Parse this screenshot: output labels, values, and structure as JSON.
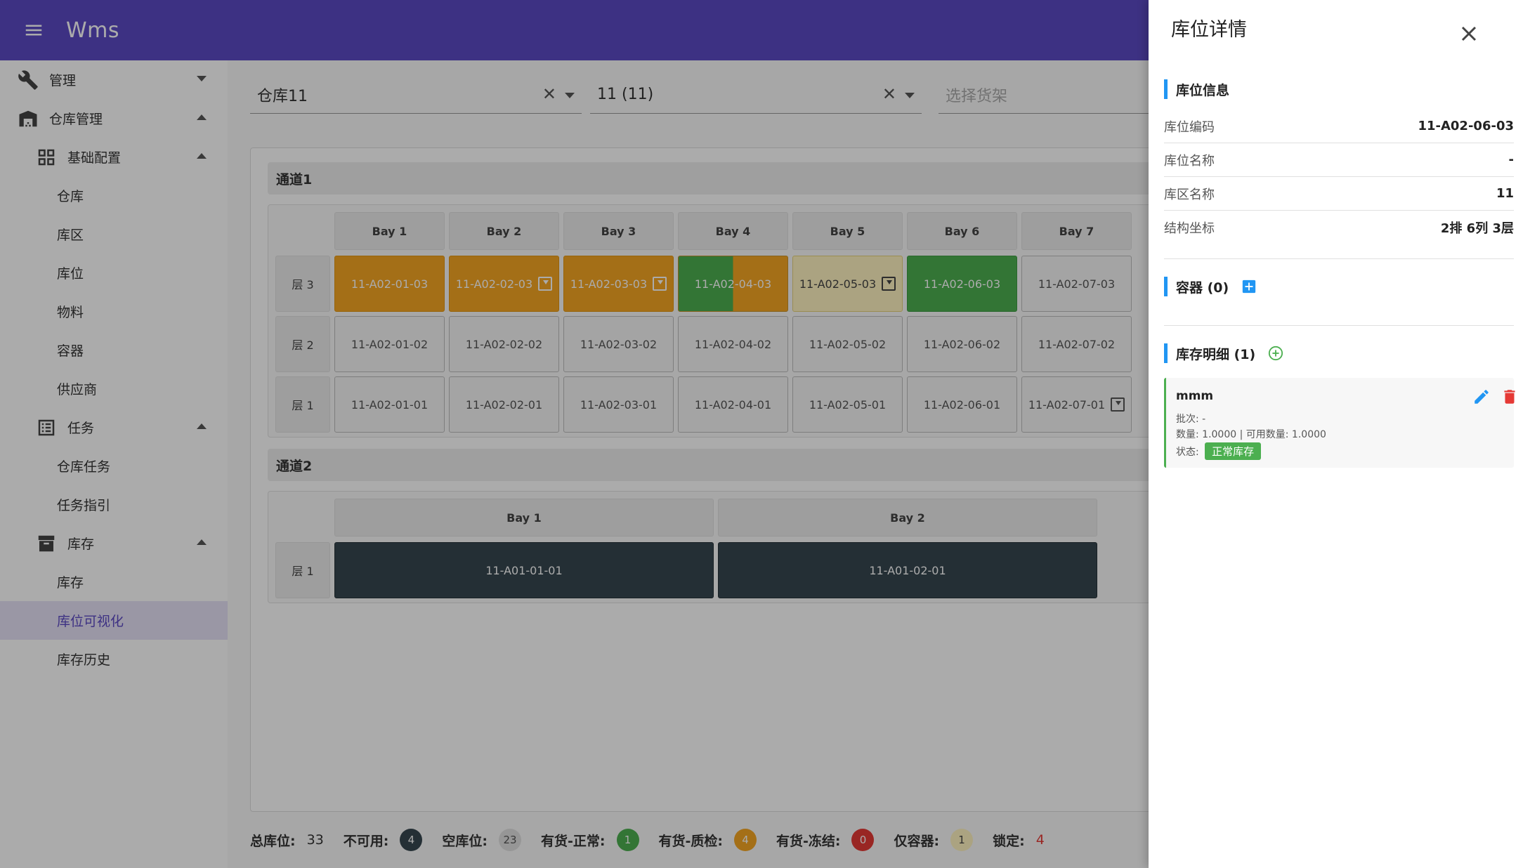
{
  "app": {
    "title": "Wms"
  },
  "sidebar": {
    "groups": [
      {
        "label": "管理"
      },
      {
        "label": "仓库管理"
      },
      {
        "label": "基础配置"
      },
      {
        "label": "任务"
      },
      {
        "label": "库存"
      }
    ],
    "items": [
      {
        "label": "仓库"
      },
      {
        "label": "库区"
      },
      {
        "label": "库位"
      },
      {
        "label": "物料"
      },
      {
        "label": "容器"
      },
      {
        "label": "供应商"
      },
      {
        "label": "仓库任务"
      },
      {
        "label": "任务指引"
      },
      {
        "label": "库存"
      },
      {
        "label": "库位可视化"
      },
      {
        "label": "库存历史"
      }
    ]
  },
  "filters": {
    "warehouse": "仓库11",
    "zone": "11 (11)",
    "shelf_placeholder": "选择货架"
  },
  "aisle1": {
    "name": "通道1",
    "bays": [
      "Bay 1",
      "Bay 2",
      "Bay 3",
      "Bay 4",
      "Bay 5",
      "Bay 6",
      "Bay 7"
    ],
    "levels": [
      {
        "label": "层 3",
        "cells": [
          {
            "code": "11-A02-01-03",
            "status": "qc",
            "icon": ""
          },
          {
            "code": "11-A02-02-03",
            "status": "qc",
            "icon": "inbox-icon"
          },
          {
            "code": "11-A02-03-03",
            "status": "qc",
            "icon": "inbox-icon"
          },
          {
            "code": "11-A02-04-03",
            "status": "split",
            "icon": ""
          },
          {
            "code": "11-A02-05-03",
            "status": "container",
            "icon": "inbox-icon"
          },
          {
            "code": "11-A02-06-03",
            "status": "normal",
            "icon": ""
          },
          {
            "code": "11-A02-07-03",
            "status": "empty",
            "icon": ""
          }
        ]
      },
      {
        "label": "层 2",
        "cells": [
          {
            "code": "11-A02-01-02",
            "status": "empty",
            "icon": ""
          },
          {
            "code": "11-A02-02-02",
            "status": "empty",
            "icon": ""
          },
          {
            "code": "11-A02-03-02",
            "status": "empty",
            "icon": ""
          },
          {
            "code": "11-A02-04-02",
            "status": "empty",
            "icon": ""
          },
          {
            "code": "11-A02-05-02",
            "status": "empty",
            "icon": ""
          },
          {
            "code": "11-A02-06-02",
            "status": "empty",
            "icon": ""
          },
          {
            "code": "11-A02-07-02",
            "status": "empty",
            "icon": ""
          }
        ]
      },
      {
        "label": "层 1",
        "cells": [
          {
            "code": "11-A02-01-01",
            "status": "empty",
            "icon": ""
          },
          {
            "code": "11-A02-02-01",
            "status": "empty",
            "icon": ""
          },
          {
            "code": "11-A02-03-01",
            "status": "empty",
            "icon": ""
          },
          {
            "code": "11-A02-04-01",
            "status": "empty",
            "icon": ""
          },
          {
            "code": "11-A02-05-01",
            "status": "empty",
            "icon": ""
          },
          {
            "code": "11-A02-06-01",
            "status": "empty",
            "icon": ""
          },
          {
            "code": "11-A02-07-01",
            "status": "empty",
            "icon": "inbox-icon"
          }
        ]
      }
    ]
  },
  "aisle2": {
    "name": "通道2",
    "bays": [
      "Bay 1",
      "Bay 2"
    ],
    "levels": [
      {
        "label": "层 1",
        "cells": [
          {
            "code": "11-A01-01-01",
            "status": "unavail",
            "icon": ""
          },
          {
            "code": "11-A01-02-01",
            "status": "unavail",
            "icon": ""
          }
        ]
      }
    ]
  },
  "stats": [
    {
      "label": "总库位:",
      "value": "33",
      "style": "plain",
      "color": "#333333"
    },
    {
      "label": "不可用:",
      "value": "4",
      "style": "badge",
      "color": "#37474f",
      "text": "#ffffff"
    },
    {
      "label": "空库位:",
      "value": "23",
      "style": "badge",
      "color": "#e0e0e0",
      "text": "#555555"
    },
    {
      "label": "有货-正常:",
      "value": "1",
      "style": "badge",
      "color": "#4caf50",
      "text": "#ffffff"
    },
    {
      "label": "有货-质检:",
      "value": "4",
      "style": "badge",
      "color": "#f5a623",
      "text": "#ffffff"
    },
    {
      "label": "有货-冻结:",
      "value": "0",
      "style": "badge",
      "color": "#e53935",
      "text": "#ffffff"
    },
    {
      "label": "仅容器:",
      "value": "1",
      "style": "badge",
      "color": "#fff4c1",
      "text": "#444444"
    },
    {
      "label": "锁定:",
      "value": "4",
      "style": "plain",
      "color": "#e53935"
    }
  ],
  "drawer": {
    "title": "库位详情",
    "info_section": "库位信息",
    "info_rows": [
      {
        "key": "库位编码",
        "value": "11-A02-06-03"
      },
      {
        "key": "库位名称",
        "value": "-"
      },
      {
        "key": "库区名称",
        "value": "11"
      },
      {
        "key": "结构坐标",
        "value": "2排 6列 3层"
      }
    ],
    "container_section": "容器 (0)",
    "inventory_section": "库存明细 (1)",
    "inventory": {
      "name": "mmm",
      "batch": "批次: -",
      "qty": "数量: 1.0000 | 可用数量: 1.0000",
      "status_label": "状态:",
      "status": "正常库存"
    }
  },
  "colors": {
    "appbar": "#5c49c4",
    "accent": "#2196f3",
    "normal": "#4caf50",
    "qc": "#f5a623",
    "frozen": "#e53935",
    "unavailable": "#37474f"
  }
}
